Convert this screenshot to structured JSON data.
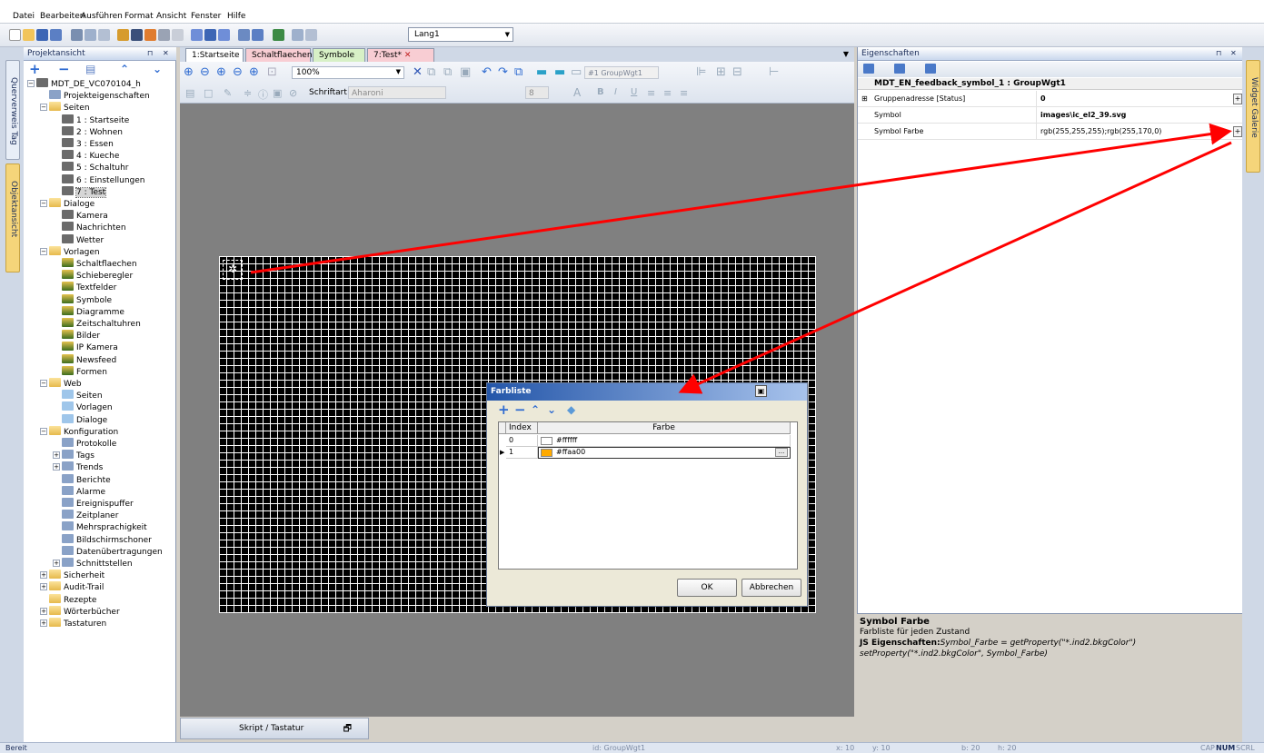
{
  "menu": [
    "Datei",
    "Bearbeiten",
    "Ausführen",
    "Format",
    "Ansicht",
    "Fenster",
    "Hilfe"
  ],
  "toolbar": {
    "language": "Lang1"
  },
  "left_side_tabs": [
    "Querverweis Tag",
    "Objektansicht"
  ],
  "project_panel": {
    "title": "Projektansicht",
    "tree": [
      {
        "label": "MDT_DE_VC070104_h",
        "level": 0,
        "icon": "project-icon",
        "expander": "−"
      },
      {
        "label": "Projekteigenschaften",
        "level": 1,
        "icon": "settings-icon",
        "expander": ""
      },
      {
        "label": "Seiten",
        "level": 1,
        "icon": "folder-icon",
        "expander": "−"
      },
      {
        "label": "1 : Startseite",
        "level": 2,
        "icon": "page-icon",
        "expander": ""
      },
      {
        "label": "2 : Wohnen",
        "level": 2,
        "icon": "page-icon",
        "expander": ""
      },
      {
        "label": "3 : Essen",
        "level": 2,
        "icon": "page-icon",
        "expander": ""
      },
      {
        "label": "4 : Kueche",
        "level": 2,
        "icon": "page-icon",
        "expander": ""
      },
      {
        "label": "5 : Schaltuhr",
        "level": 2,
        "icon": "page-icon",
        "expander": ""
      },
      {
        "label": "6 : Einstellungen",
        "level": 2,
        "icon": "page-icon",
        "expander": ""
      },
      {
        "label": "7 : Test",
        "level": 2,
        "icon": "page-icon",
        "expander": "",
        "selected": true
      },
      {
        "label": "Dialoge",
        "level": 1,
        "icon": "folder-icon",
        "expander": "−"
      },
      {
        "label": "Kamera",
        "level": 2,
        "icon": "page-icon",
        "expander": ""
      },
      {
        "label": "Nachrichten",
        "level": 2,
        "icon": "page-icon",
        "expander": ""
      },
      {
        "label": "Wetter",
        "level": 2,
        "icon": "page-icon",
        "expander": ""
      },
      {
        "label": "Vorlagen",
        "level": 1,
        "icon": "folder-icon",
        "expander": "−"
      },
      {
        "label": "Schaltflaechen",
        "level": 2,
        "icon": "template-icon",
        "expander": ""
      },
      {
        "label": "Schieberegler",
        "level": 2,
        "icon": "template-icon",
        "expander": ""
      },
      {
        "label": "Textfelder",
        "level": 2,
        "icon": "template-icon",
        "expander": ""
      },
      {
        "label": "Symbole",
        "level": 2,
        "icon": "template-icon",
        "expander": ""
      },
      {
        "label": "Diagramme",
        "level": 2,
        "icon": "template-icon",
        "expander": ""
      },
      {
        "label": "Zeitschaltuhren",
        "level": 2,
        "icon": "template-icon",
        "expander": ""
      },
      {
        "label": "Bilder",
        "level": 2,
        "icon": "template-icon",
        "expander": ""
      },
      {
        "label": "IP Kamera",
        "level": 2,
        "icon": "template-icon",
        "expander": ""
      },
      {
        "label": "Newsfeed",
        "level": 2,
        "icon": "template-icon",
        "expander": ""
      },
      {
        "label": "Formen",
        "level": 2,
        "icon": "template-icon",
        "expander": ""
      },
      {
        "label": "Web",
        "level": 1,
        "icon": "folder-icon",
        "expander": "−"
      },
      {
        "label": "Seiten",
        "level": 2,
        "icon": "web-icon",
        "expander": ""
      },
      {
        "label": "Vorlagen",
        "level": 2,
        "icon": "web-icon",
        "expander": ""
      },
      {
        "label": "Dialoge",
        "level": 2,
        "icon": "web-icon",
        "expander": ""
      },
      {
        "label": "Konfiguration",
        "level": 1,
        "icon": "folder-icon",
        "expander": "−"
      },
      {
        "label": "Protokolle",
        "level": 2,
        "icon": "config-icon",
        "expander": ""
      },
      {
        "label": "Tags",
        "level": 2,
        "icon": "config-icon",
        "expander": "+"
      },
      {
        "label": "Trends",
        "level": 2,
        "icon": "config-icon",
        "expander": "+"
      },
      {
        "label": "Berichte",
        "level": 2,
        "icon": "config-icon",
        "expander": ""
      },
      {
        "label": "Alarme",
        "level": 2,
        "icon": "config-icon",
        "expander": ""
      },
      {
        "label": "Ereignispuffer",
        "level": 2,
        "icon": "config-icon",
        "expander": ""
      },
      {
        "label": "Zeitplaner",
        "level": 2,
        "icon": "config-icon",
        "expander": ""
      },
      {
        "label": "Mehrsprachigkeit",
        "level": 2,
        "icon": "config-icon",
        "expander": ""
      },
      {
        "label": "Bildschirmschoner",
        "level": 2,
        "icon": "config-icon",
        "expander": ""
      },
      {
        "label": "Datenübertragungen",
        "level": 2,
        "icon": "config-icon",
        "expander": ""
      },
      {
        "label": "Schnittstellen",
        "level": 2,
        "icon": "config-icon",
        "expander": "+"
      },
      {
        "label": "Sicherheit",
        "level": 1,
        "icon": "folder-icon",
        "expander": "+"
      },
      {
        "label": "Audit-Trail",
        "level": 1,
        "icon": "folder-icon",
        "expander": "+"
      },
      {
        "label": "Rezepte",
        "level": 1,
        "icon": "folder-icon",
        "expander": ""
      },
      {
        "label": "Wörterbücher",
        "level": 1,
        "icon": "folder-icon",
        "expander": "+"
      },
      {
        "label": "Tastaturen",
        "level": 1,
        "icon": "folder-icon",
        "expander": "+"
      }
    ]
  },
  "doc_tabs": [
    {
      "label": "1:Startseite",
      "color": "#ffffff"
    },
    {
      "label": "Schaltflaechen",
      "color": "#f8cdd3"
    },
    {
      "label": "Symbole",
      "color": "#d7f0c6"
    },
    {
      "label": "7:Test*",
      "color": "#f8cdd3",
      "active": true
    }
  ],
  "editor": {
    "zoom": "100%",
    "group_selector": "#1 GroupWgt1",
    "font_label": "Schriftart",
    "font_value": "Aharoni",
    "font_size": "8"
  },
  "bottom_tab": {
    "label": "Skript / Tastatur"
  },
  "dialog": {
    "title": "Farbliste",
    "columns": [
      "Index",
      "Farbe"
    ],
    "rows": [
      {
        "index": "0",
        "color": "#ffffff",
        "swatch": "#ffffff"
      },
      {
        "index": "1",
        "color": "#ffaa00",
        "swatch": "#ffaa00",
        "selected": true
      }
    ],
    "ok": "OK",
    "cancel": "Abbrechen"
  },
  "properties": {
    "title": "Eigenschaften",
    "object": "MDT_EN_feedback_symbol_1 : GroupWgt1",
    "rows": [
      {
        "key": "Gruppenadresse [Status]",
        "value": "0",
        "value_bold": true,
        "expander": true,
        "button": "+"
      },
      {
        "key": "Symbol",
        "value": "images\\ic_el2_39.svg",
        "value_bold": true
      },
      {
        "key": "Symbol Farbe",
        "value": "rgb(255,255,255);rgb(255,170,0)",
        "button": "+"
      }
    ]
  },
  "description": {
    "title": "Symbol Farbe",
    "body": "Farbliste für jeden Zustand",
    "js_label": "JS Eigenschaften:",
    "js_line1": "Symbol_Farbe = getProperty(\"*.ind2.bkgColor\")",
    "js_line2": "setProperty(\"*.ind2.bkgColor\", Symbol_Farbe)"
  },
  "right_side_tabs": [
    "Widget Galerie"
  ],
  "status": {
    "ready": "Bereit",
    "id": "id: GroupWgt1",
    "x": "x: 10",
    "y": "y: 10",
    "w": "b: 20",
    "h": "h: 20",
    "caps": "CAP",
    "num": "NUM",
    "scrl": "SCRL"
  },
  "colors": {
    "arrow": "#ff0000",
    "dialog_title": "#2456a9",
    "highlight_tab": "#f5d57a"
  }
}
